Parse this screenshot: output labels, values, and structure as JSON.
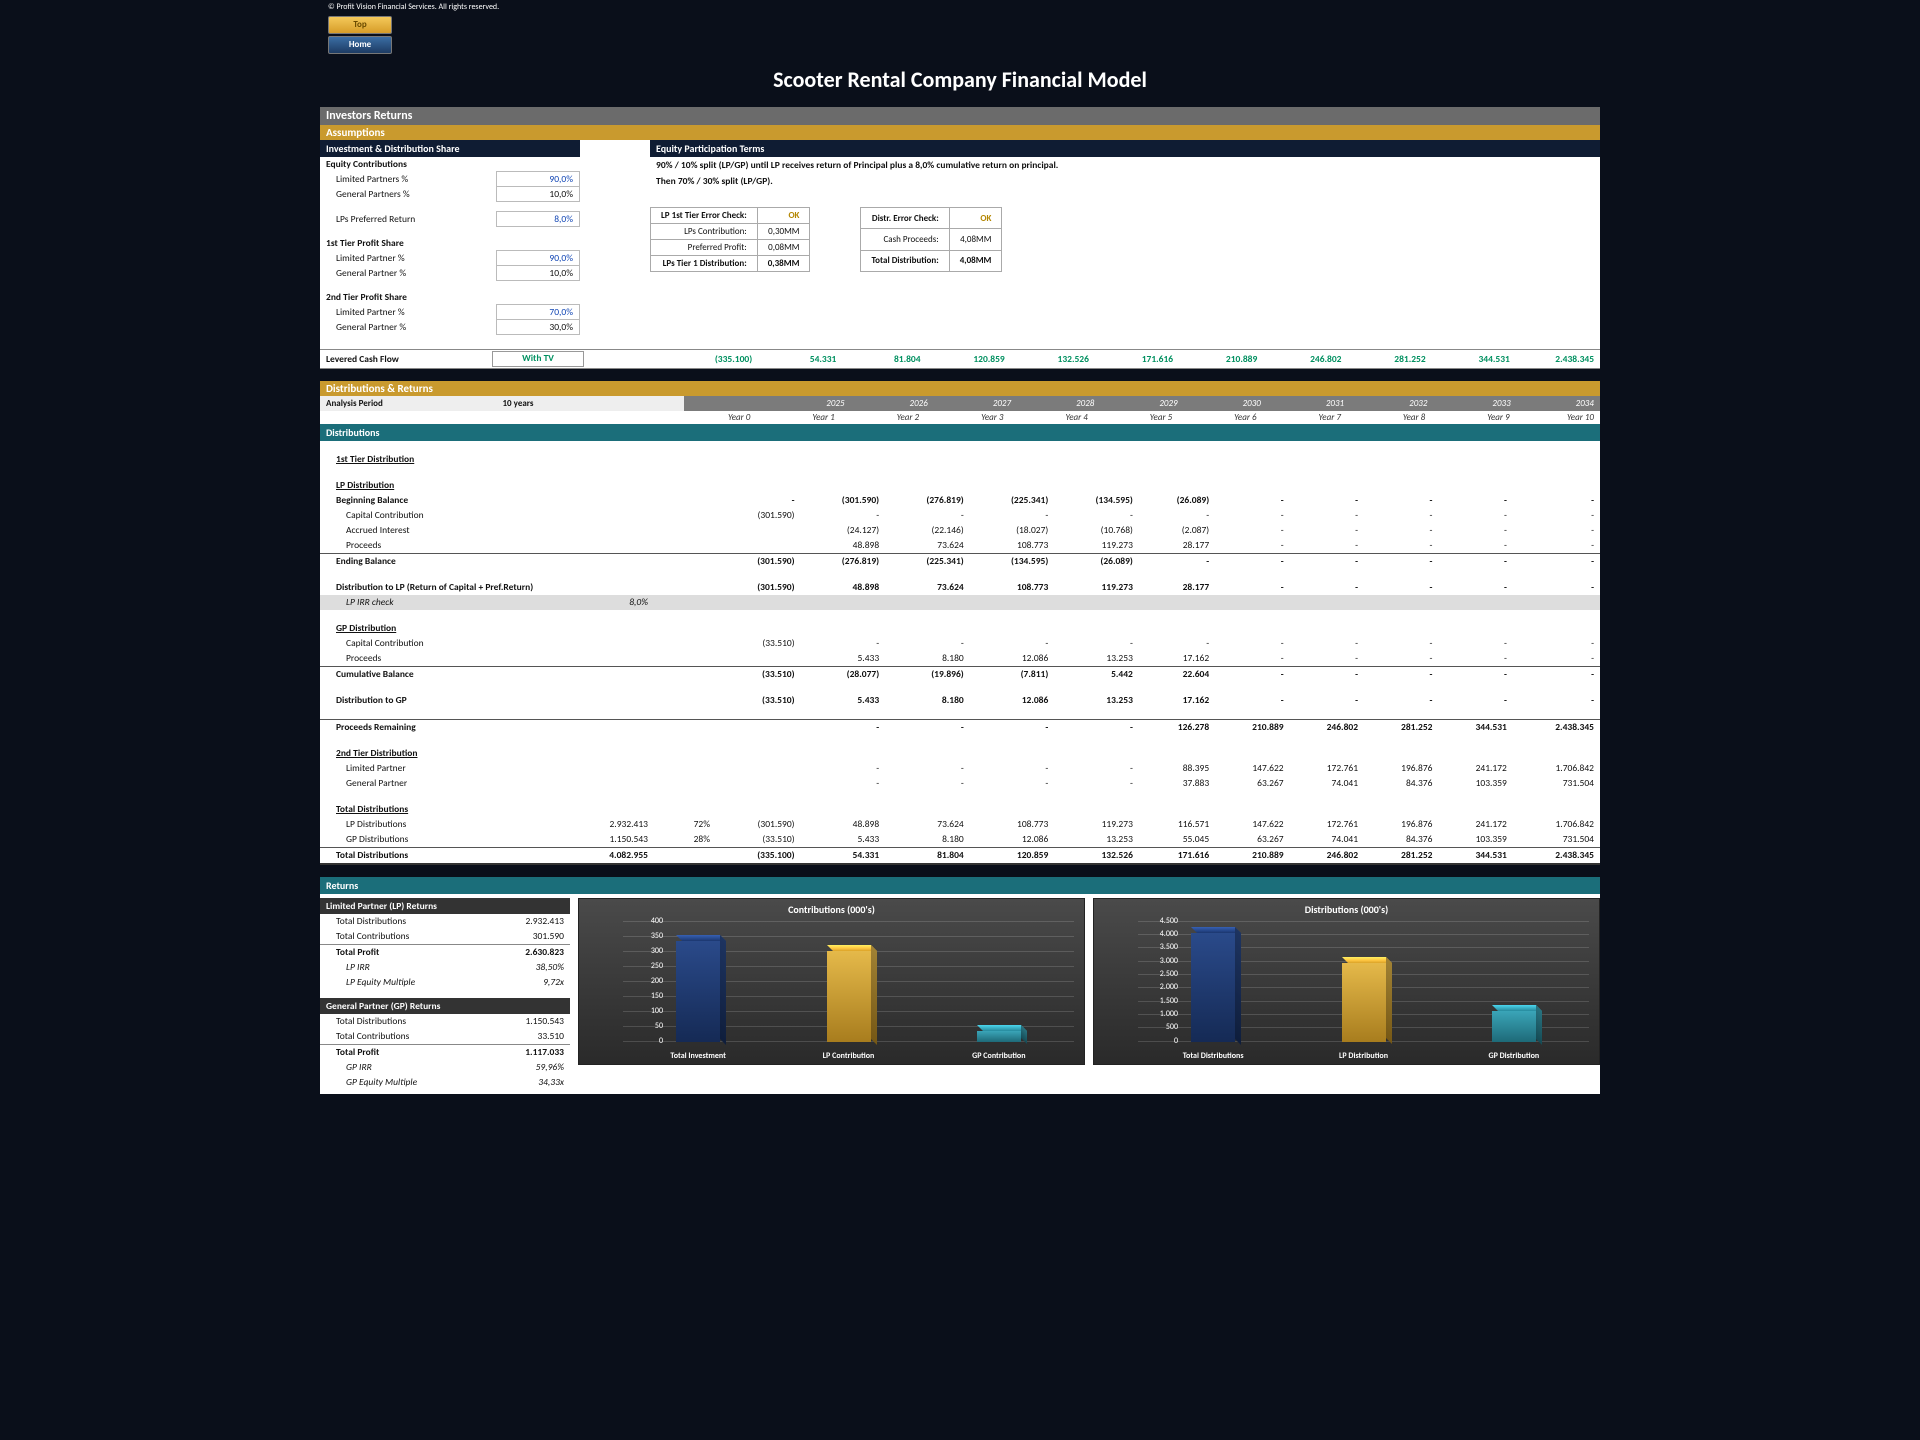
{
  "copyright": "© Profit Vision Financial Services. All rights reserved.",
  "buttons": {
    "top": "Top",
    "home": "Home"
  },
  "title": "Scooter Rental Company Financial Model",
  "sections": {
    "investors_returns": "Investors Returns",
    "assumptions": "Assumptions",
    "inv_share": "Investment & Distribution Share",
    "eq_terms": "Equity Participation Terms",
    "dist_returns": "Distributions & Returns",
    "distributions": "Distributions",
    "returns": "Returns"
  },
  "assump": {
    "eq_contrib": "Equity Contributions",
    "lp_pct_l": "Limited Partners %",
    "lp_pct_v": "90,0%",
    "gp_pct_l": "General Partners %",
    "gp_pct_v": "10,0%",
    "lp_pref_l": "LPs Preferred Return",
    "lp_pref_v": "8,0%",
    "t1_hdr": "1st Tier Profit Share",
    "t1_lp_l": "Limited Partner %",
    "t1_lp_v": "90,0%",
    "t1_gp_l": "General Partner %",
    "t1_gp_v": "10,0%",
    "t2_hdr": "2nd Tier Profit Share",
    "t2_lp_l": "Limited Partner %",
    "t2_lp_v": "70,0%",
    "t2_gp_l": "General Partner %",
    "t2_gp_v": "30,0%"
  },
  "terms": {
    "line1": "90% / 10% split (LP/GP) until LP receives return of Principal plus a 8,0% cumulative return on principal.",
    "line2": "Then 70% / 30% split (LP/GP)."
  },
  "chk1": {
    "r0l": "LP 1st Tier Error Check:",
    "r0v": "OK",
    "r1l": "LPs Contribution:",
    "r1v": "0,30MM",
    "r2l": "Preferred Profit:",
    "r2v": "0,08MM",
    "r3l": "LPs Tier 1 Distribution:",
    "r3v": "0,38MM"
  },
  "chk2": {
    "r0l": "Distr. Error Check:",
    "r0v": "OK",
    "r1l": "Cash Proceeds:",
    "r1v": "4,08MM",
    "r2l": "Total Distribution:",
    "r2v": "4,08MM"
  },
  "cf": {
    "label": "Levered Cash Flow",
    "with": "With TV",
    "v": [
      "(335.100)",
      "54.331",
      "81.804",
      "120.859",
      "132.526",
      "171.616",
      "210.889",
      "246.802",
      "281.252",
      "344.531",
      "2.438.345"
    ]
  },
  "analysis": {
    "label": "Analysis Period",
    "period": "10 years"
  },
  "years_num": [
    "2025",
    "2026",
    "2027",
    "2028",
    "2029",
    "2030",
    "2031",
    "2032",
    "2033",
    "2034"
  ],
  "years_lbl": [
    "Year 0",
    "Year 1",
    "Year 2",
    "Year 3",
    "Year 4",
    "Year 5",
    "Year 6",
    "Year 7",
    "Year 8",
    "Year 9",
    "Year 10"
  ],
  "dist": {
    "t1": "1st Tier Distribution",
    "lp": "LP Distribution",
    "bb": {
      "l": "Beginning Balance",
      "v": [
        "-",
        "(301.590)",
        "(276.819)",
        "(225.341)",
        "(134.595)",
        "(26.089)",
        "-",
        "-",
        "-",
        "-",
        "-"
      ]
    },
    "cc": {
      "l": "Capital Contribution",
      "v": [
        "(301.590)",
        "-",
        "-",
        "-",
        "-",
        "-",
        "-",
        "-",
        "-",
        "-",
        "-"
      ]
    },
    "ai": {
      "l": "Accrued Interest",
      "v": [
        "",
        "(24.127)",
        "(22.146)",
        "(18.027)",
        "(10.768)",
        "(2.087)",
        "-",
        "-",
        "-",
        "-",
        "-"
      ]
    },
    "pr": {
      "l": "Proceeds",
      "v": [
        "",
        "48.898",
        "73.624",
        "108.773",
        "119.273",
        "28.177",
        "-",
        "-",
        "-",
        "-",
        "-"
      ]
    },
    "eb": {
      "l": "Ending Balance",
      "v": [
        "(301.590)",
        "(276.819)",
        "(225.341)",
        "(134.595)",
        "(26.089)",
        "-",
        "-",
        "-",
        "-",
        "-",
        "-"
      ]
    },
    "dlp": {
      "l": "Distribution to LP (Return of Capital + Pref.Return)",
      "v": [
        "(301.590)",
        "48.898",
        "73.624",
        "108.773",
        "119.273",
        "28.177",
        "-",
        "-",
        "-",
        "-",
        "-"
      ]
    },
    "irr": {
      "l": "LP IRR check",
      "v": "8,0%"
    },
    "gp": "GP Distribution",
    "gpcc": {
      "l": "Capital Contribution",
      "v": [
        "(33.510)",
        "-",
        "-",
        "-",
        "-",
        "-",
        "-",
        "-",
        "-",
        "-",
        "-"
      ]
    },
    "gppr": {
      "l": "Proceeds",
      "v": [
        "",
        "5.433",
        "8.180",
        "12.086",
        "13.253",
        "17.162",
        "-",
        "-",
        "-",
        "-",
        "-"
      ]
    },
    "cum": {
      "l": "Cumulative Balance",
      "v": [
        "(33.510)",
        "(28.077)",
        "(19.896)",
        "(7.811)",
        "5.442",
        "22.604",
        "-",
        "-",
        "-",
        "-",
        "-"
      ]
    },
    "dgp": {
      "l": "Distribution to GP",
      "v": [
        "(33.510)",
        "5.433",
        "8.180",
        "12.086",
        "13.253",
        "17.162",
        "-",
        "-",
        "-",
        "-",
        "-"
      ]
    },
    "prem": {
      "l": "Proceeds Remaining",
      "v": [
        "",
        "-",
        "-",
        "-",
        "-",
        "126.278",
        "210.889",
        "246.802",
        "281.252",
        "344.531",
        "2.438.345"
      ]
    },
    "t2": "2nd Tier Distribution",
    "t2lp": {
      "l": "Limited Partner",
      "v": [
        "",
        "-",
        "-",
        "-",
        "-",
        "88.395",
        "147.622",
        "172.761",
        "196.876",
        "241.172",
        "1.706.842"
      ]
    },
    "t2gp": {
      "l": "General Partner",
      "v": [
        "",
        "-",
        "-",
        "-",
        "-",
        "37.883",
        "63.267",
        "74.041",
        "84.376",
        "103.359",
        "731.504"
      ]
    },
    "tot": "Total Distributions",
    "tlp": {
      "l": "LP Distributions",
      "t1": "2.932.413",
      "t2": "72%",
      "v": [
        "(301.590)",
        "48.898",
        "73.624",
        "108.773",
        "119.273",
        "116.571",
        "147.622",
        "172.761",
        "196.876",
        "241.172",
        "1.706.842"
      ]
    },
    "tgp": {
      "l": "GP Distributions",
      "t1": "1.150.543",
      "t2": "28%",
      "v": [
        "(33.510)",
        "5.433",
        "8.180",
        "12.086",
        "13.253",
        "55.045",
        "63.267",
        "74.041",
        "84.376",
        "103.359",
        "731.504"
      ]
    },
    "ttd": {
      "l": "Total Distributions",
      "t1": "4.082.955",
      "v": [
        "(335.100)",
        "54.331",
        "81.804",
        "120.859",
        "132.526",
        "171.616",
        "210.889",
        "246.802",
        "281.252",
        "344.531",
        "2.438.345"
      ]
    }
  },
  "ret": {
    "lp_hdr": "Limited Partner (LP) Returns",
    "lp": {
      "td_l": "Total Distributions",
      "td_v": "2.932.413",
      "tc_l": "Total Contributions",
      "tc_v": "301.590",
      "tp_l": "Total Profit",
      "tp_v": "2.630.823",
      "irr_l": "LP IRR",
      "irr_v": "38,50%",
      "em_l": "LP Equity Multiple",
      "em_v": "9,72x"
    },
    "gp_hdr": "General Partner (GP) Returns",
    "gp": {
      "td_l": "Total Distributions",
      "td_v": "1.150.543",
      "tc_l": "Total Contributions",
      "tc_v": "33.510",
      "tp_l": "Total Profit",
      "tp_v": "1.117.033",
      "irr_l": "GP IRR",
      "irr_v": "59,96%",
      "em_l": "GP Equity Multiple",
      "em_v": "34,33x"
    }
  },
  "chart_data": [
    {
      "type": "bar",
      "title": "Contributions (000's)",
      "categories": [
        "Total Investment",
        "LP Contribution",
        "GP Contribution"
      ],
      "values": [
        335,
        302,
        34
      ],
      "ylim": [
        0,
        400
      ],
      "yticks": [
        0,
        50,
        100,
        150,
        200,
        250,
        300,
        350,
        400
      ]
    },
    {
      "type": "bar",
      "title": "Distributions (000's)",
      "categories": [
        "Total Distributions",
        "LP Distribution",
        "GP Distribution"
      ],
      "values": [
        4083,
        2932,
        1151
      ],
      "ylim": [
        0,
        4500
      ],
      "yticks": [
        0,
        500,
        1000,
        1500,
        2000,
        2500,
        3000,
        3500,
        4000,
        4500
      ]
    }
  ]
}
